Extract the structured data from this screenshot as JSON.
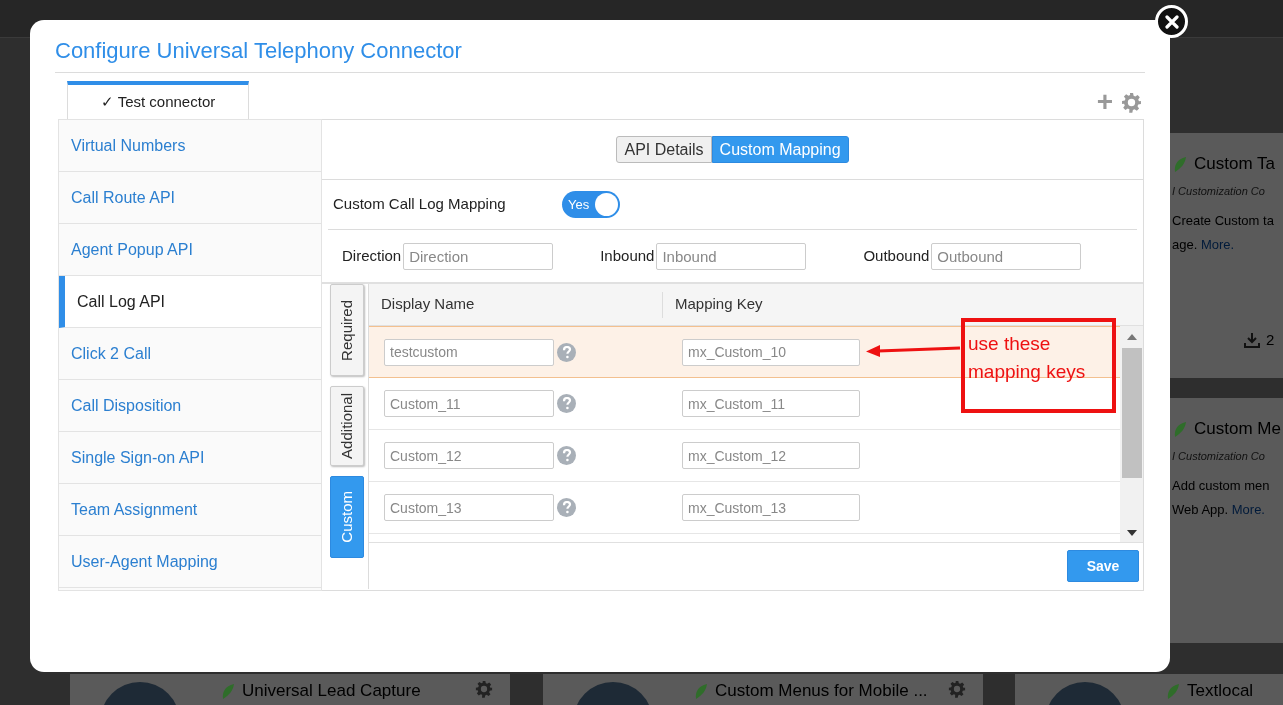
{
  "background": {
    "side_cards": [
      {
        "title": "Custom Ta",
        "category": "I Customization Co",
        "lines": [
          "Create Custom ta"
        ],
        "tail": "age.",
        "link": "More.",
        "count": "2"
      },
      {
        "title": "Custom Me",
        "category": "I Customization Co",
        "lines": [
          "Add custom men"
        ],
        "tail": "Web App.",
        "link": "More."
      }
    ],
    "bottom_cards": [
      {
        "title": "Universal Lead Capture",
        "settings": true
      },
      {
        "title": "Custom Menus for Mobile ...",
        "settings": true
      },
      {
        "title": "Textlocal"
      }
    ]
  },
  "modal": {
    "title": "Configure Universal Telephony Connector",
    "connector_tabs": [
      {
        "label": "✓ Test connector",
        "selected": true
      }
    ],
    "toolbar": [
      "+"
    ],
    "sidebar": {
      "items": [
        {
          "label": "Virtual Numbers",
          "selected": false
        },
        {
          "label": "Call Route API",
          "selected": false
        },
        {
          "label": "Agent Popup API",
          "selected": false
        },
        {
          "label": "Call Log API",
          "selected": true
        },
        {
          "label": "Click 2 Call",
          "selected": false
        },
        {
          "label": "Call Disposition",
          "selected": false
        },
        {
          "label": "Single Sign-on API",
          "selected": false
        },
        {
          "label": "Team Assignment",
          "selected": false
        },
        {
          "label": "User-Agent Mapping",
          "selected": false
        }
      ]
    },
    "view_tabs": [
      {
        "label": "API Details",
        "selected": false
      },
      {
        "label": "Custom Mapping",
        "selected": true
      }
    ],
    "custom_call_log_mapping": {
      "label": "Custom Call Log Mapping",
      "toggle_text": "Yes",
      "on": true
    },
    "fields": [
      {
        "label": "Direction",
        "placeholder": "Direction"
      },
      {
        "label": "Inbound",
        "placeholder": "Inbound"
      },
      {
        "label": "Outbound",
        "placeholder": "Outbound"
      }
    ],
    "side_tabs": [
      {
        "label": "Required",
        "selected": false
      },
      {
        "label": "Additional",
        "selected": false
      },
      {
        "label": "Custom",
        "selected": true
      }
    ],
    "table": {
      "columns": [
        "Display Name",
        "Mapping Key"
      ],
      "rows": [
        {
          "display_name": "testcustom",
          "mapping_key": "mx_Custom_10",
          "highlighted": true
        },
        {
          "display_name": "Custom_11",
          "mapping_key": "mx_Custom_11",
          "highlighted": false
        },
        {
          "display_name": "Custom_12",
          "mapping_key": "mx_Custom_12",
          "highlighted": false
        },
        {
          "display_name": "Custom_13",
          "mapping_key": "mx_Custom_13",
          "highlighted": false
        }
      ]
    },
    "save_button": "Save",
    "annotation": {
      "lines": [
        "use these",
        "mapping keys"
      ]
    }
  }
}
